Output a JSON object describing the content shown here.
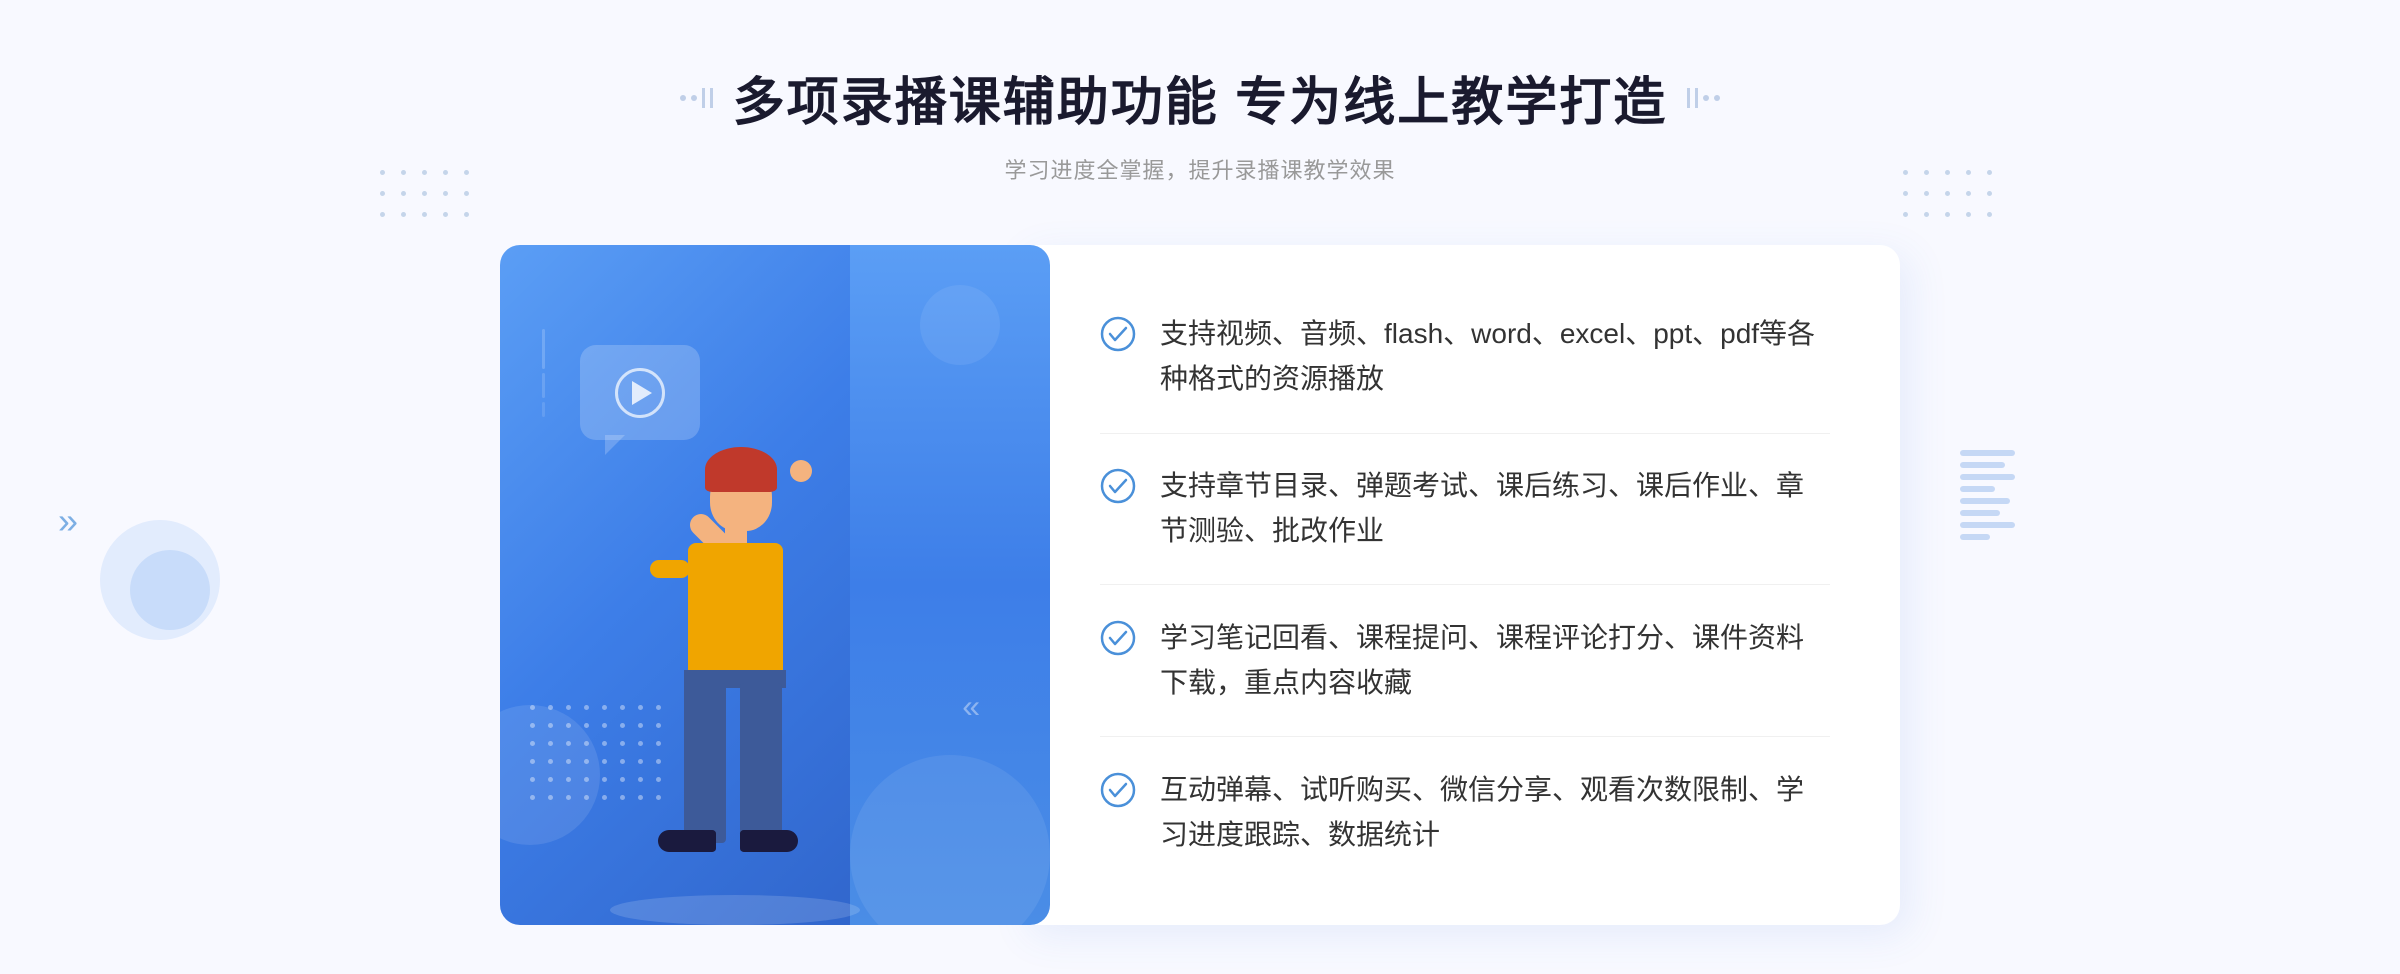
{
  "page": {
    "background": "#f8f9ff"
  },
  "header": {
    "main_title": "多项录播课辅助功能 专为线上教学打造",
    "subtitle": "学习进度全掌握，提升录播课教学效果"
  },
  "features": [
    {
      "id": 1,
      "text": "支持视频、音频、flash、word、excel、ppt、pdf等各种格式的资源播放"
    },
    {
      "id": 2,
      "text": "支持章节目录、弹题考试、课后练习、课后作业、章节测验、批改作业"
    },
    {
      "id": 3,
      "text": "学习笔记回看、课程提问、课程评论打分、课件资料下载，重点内容收藏"
    },
    {
      "id": 4,
      "text": "互动弹幕、试听购买、微信分享、观看次数限制、学习进度跟踪、数据统计"
    }
  ],
  "decorations": {
    "arrows_label": "»",
    "check_color": "#4a90d9"
  }
}
